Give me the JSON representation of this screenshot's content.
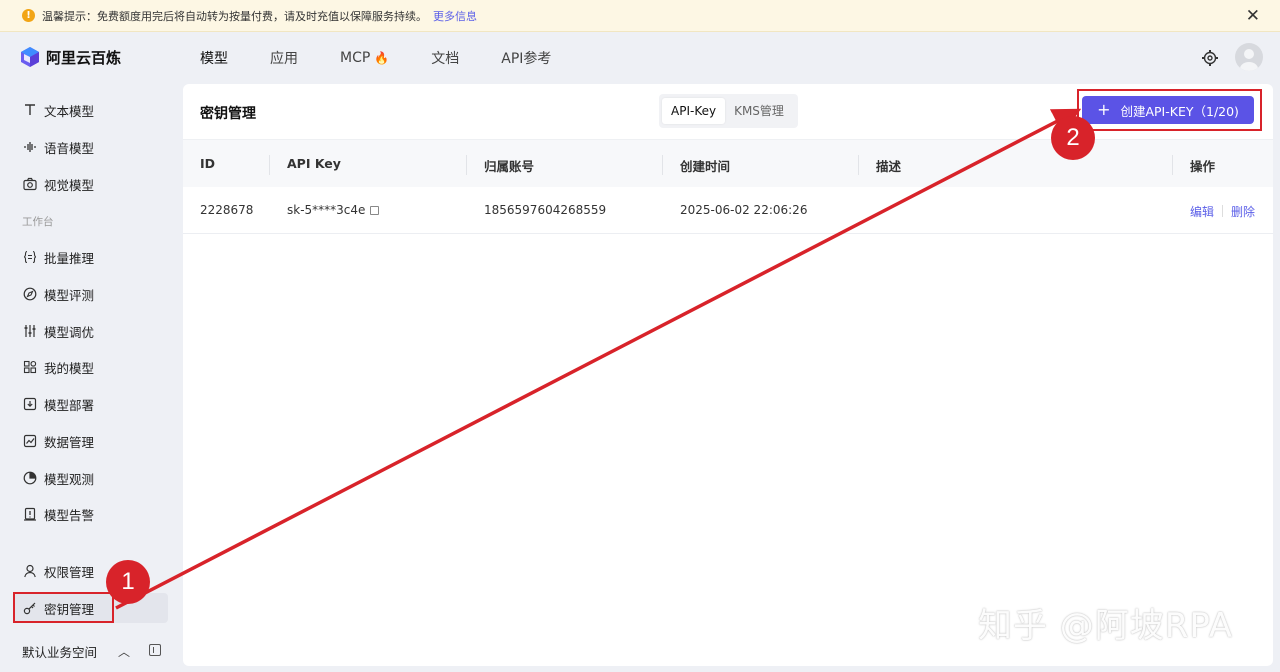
{
  "notice": {
    "text": "温馨提示：免费额度用完后将自动转为按量付费，请及时充值以保障服务持续。",
    "more_link": "更多信息"
  },
  "app": {
    "name": "阿里云百炼"
  },
  "topnav": {
    "items": [
      "模型",
      "应用",
      "MCP",
      "文档",
      "API参考"
    ],
    "active": "模型"
  },
  "sidebar": {
    "items": [
      {
        "label": "文本模型",
        "icon": "text-icon"
      },
      {
        "label": "语音模型",
        "icon": "waveform-icon"
      },
      {
        "label": "视觉模型",
        "icon": "camera-icon"
      }
    ],
    "group_label": "工作台",
    "work_items": [
      {
        "label": "批量推理",
        "icon": "braces-icon"
      },
      {
        "label": "模型评测",
        "icon": "compass-icon"
      },
      {
        "label": "模型调优",
        "icon": "sliders-icon"
      },
      {
        "label": "我的模型",
        "icon": "grid-icon"
      },
      {
        "label": "模型部署",
        "icon": "deploy-icon"
      },
      {
        "label": "数据管理",
        "icon": "chart-icon"
      },
      {
        "label": "模型观测",
        "icon": "pie-icon"
      },
      {
        "label": "模型告警",
        "icon": "alert-icon"
      }
    ],
    "admin_items": [
      {
        "label": "权限管理",
        "icon": "user-icon"
      },
      {
        "label": "密钥管理",
        "icon": "key-icon",
        "active": true
      }
    ],
    "workspace": "默认业务空间"
  },
  "main": {
    "title": "密钥管理",
    "tabs": [
      "API-Key",
      "KMS管理"
    ],
    "active_tab": "API-Key",
    "create_button": "创建API-KEY（1/20)",
    "table": {
      "columns": [
        "ID",
        "API Key",
        "归属账号",
        "创建时间",
        "描述",
        "操作"
      ],
      "rows": [
        {
          "id": "2228678",
          "api_key": "sk-5****3c4e",
          "account": "1856597604268559",
          "created": "2025-06-02 22:06:26",
          "description": "",
          "actions": [
            "编辑",
            "删除"
          ]
        }
      ]
    }
  },
  "annotations": {
    "badges": [
      "1",
      "2"
    ],
    "color": "#d8232a"
  },
  "watermark": "知乎 @阿坡RPA",
  "colors": {
    "accent": "#5b53e6",
    "link": "#5b5fe8",
    "annotation": "#d8232a",
    "notice_bg": "#fdf7e4"
  }
}
